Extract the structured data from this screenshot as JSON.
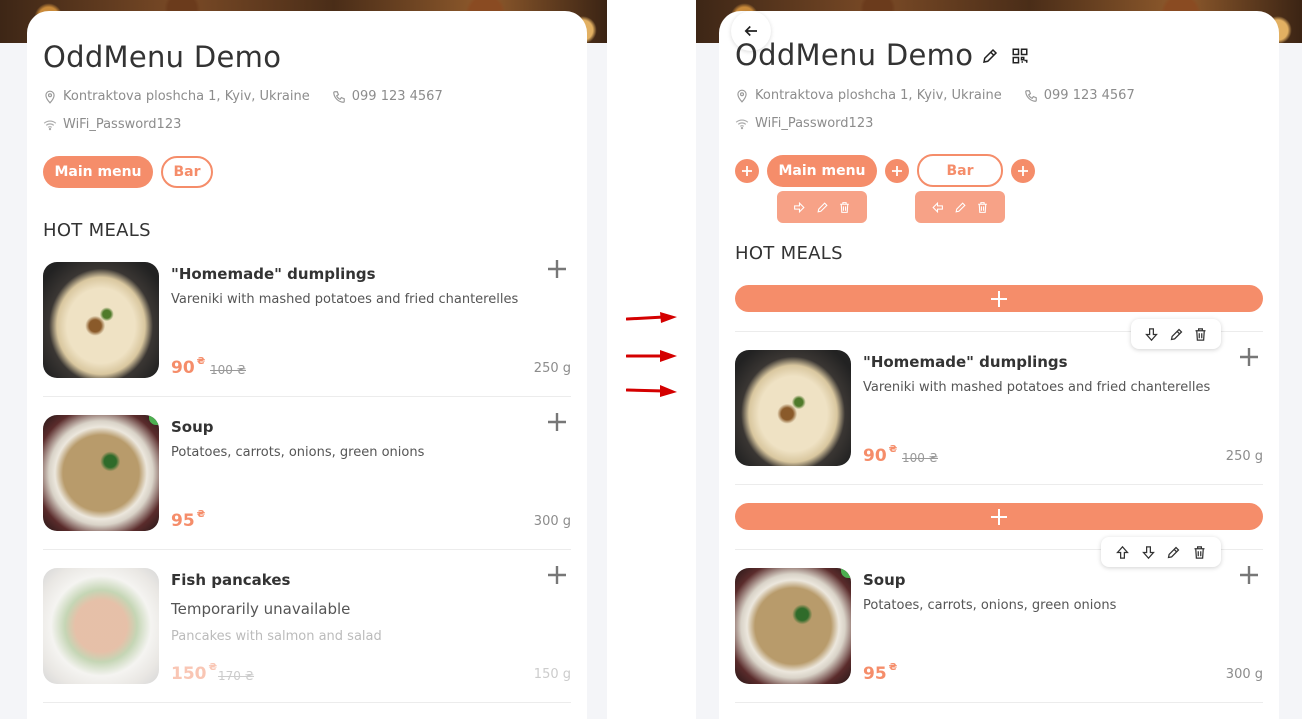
{
  "left": {
    "title": "OddMenu Demo",
    "address": "Kontraktova ploshcha 1, Kyiv, Ukraine",
    "phone": "099 123 4567",
    "wifi": "WiFi_Password123",
    "tabs": [
      {
        "label": "Main menu"
      },
      {
        "label": "Bar"
      }
    ],
    "section": "HOT MEALS",
    "items": [
      {
        "name": "\"Homemade\" dumplings",
        "desc": "Vareniki with mashed potatoes and fried chanterelles",
        "price": "90",
        "currency": "₴",
        "old_price": "100 ₴",
        "weight": "250 g"
      },
      {
        "name": "Soup",
        "desc": "Potatoes, carrots, onions, green onions",
        "price": "95",
        "currency": "₴",
        "weight": "300 g"
      },
      {
        "name": "Fish pancakes",
        "status": "Temporarily unavailable",
        "desc": "Pancakes with salmon and salad",
        "price": "150",
        "currency": "₴",
        "old_price": "170 ₴",
        "weight": "150 g"
      }
    ]
  },
  "right": {
    "title": "OddMenu Demo",
    "address": "Kontraktova ploshcha 1, Kyiv, Ukraine",
    "phone": "099 123 4567",
    "wifi": "WiFi_Password123",
    "tabs": [
      {
        "label": "Main menu"
      },
      {
        "label": "Bar"
      }
    ],
    "section": "HOT MEALS",
    "items": [
      {
        "name": "\"Homemade\" dumplings",
        "desc": "Vareniki with mashed potatoes and fried chanterelles",
        "price": "90",
        "currency": "₴",
        "old_price": "100 ₴",
        "weight": "250 g"
      },
      {
        "name": "Soup",
        "desc": "Potatoes, carrots, onions, green onions",
        "price": "95",
        "currency": "₴",
        "weight": "300 g"
      }
    ]
  },
  "colors": {
    "accent": "#f58d6a",
    "arrow": "#d40000"
  },
  "icons": [
    "location-pin-icon",
    "phone-icon",
    "wifi-icon",
    "plus-icon",
    "pencil-icon",
    "qr-code-icon",
    "arrow-left-icon",
    "arrow-right-icon",
    "arrow-up-icon",
    "arrow-down-icon",
    "trash-icon",
    "back-arrow-icon"
  ]
}
